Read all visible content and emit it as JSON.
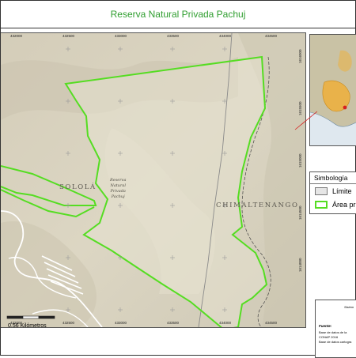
{
  "title": "Reserva Natural Privada Pachuj",
  "map": {
    "x_ticks": [
      "432000",
      "432500",
      "433000",
      "433500",
      "434000",
      "434500"
    ],
    "x_ticks_bottom": [
      "432000",
      "432500",
      "433000",
      "433500",
      "434000",
      "434500"
    ],
    "y_ticks": [
      "1616000",
      "1615500",
      "1615000",
      "1614500",
      "1614000"
    ],
    "place_labels": {
      "solola": "SOLOLÁ",
      "chimaltenango": "CHIMALTENANGO"
    },
    "reserve_label": [
      "Reserva",
      "Natural",
      "Privada",
      "Pachuj"
    ],
    "boundary_color": "#55dd22",
    "municipal_line_color": "#8a8a8a"
  },
  "scale_bar": {
    "label": "0.56 Kilómetros"
  },
  "legend": {
    "title": "Simbología",
    "items": [
      {
        "label": "Límite",
        "swatch": "#e6e6e6"
      },
      {
        "label": "Área pr",
        "swatch": "#55dd22"
      }
    ]
  },
  "info": {
    "system_label": "Sistem",
    "fuente_label": "Fuente:",
    "sources": [
      "Base de datos de la",
      "CONAP 2016",
      "Base de datos cartogra"
    ]
  }
}
